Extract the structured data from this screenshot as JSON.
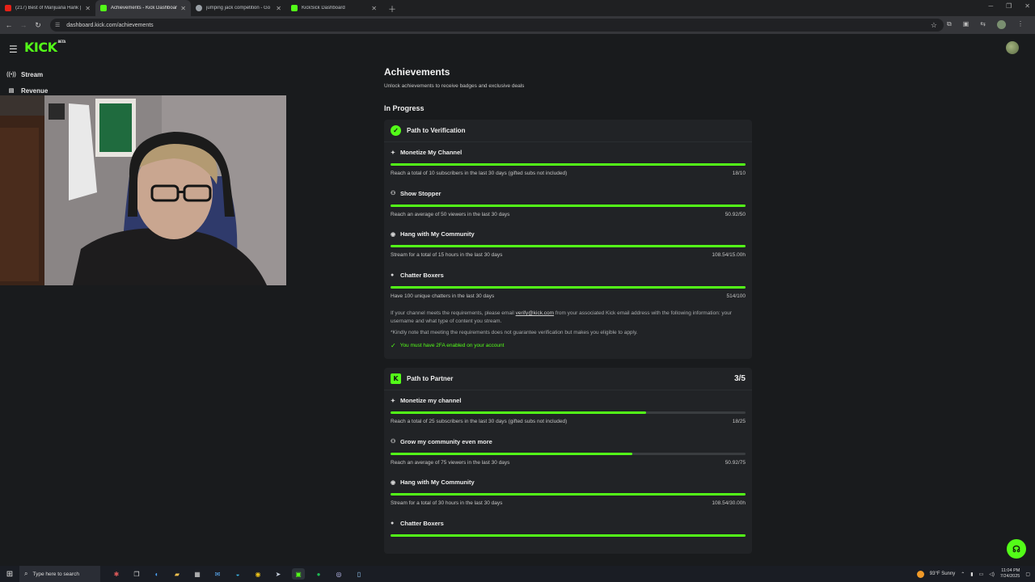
{
  "browser": {
    "tabs": [
      {
        "title": "(217) Best of Marijuana Hank |",
        "favicon_color": "#e62117",
        "active": false
      },
      {
        "title": "Achievements - Kick Dashboard",
        "favicon_color": "#53fc18",
        "active": true
      },
      {
        "title": "jumping jack competition - Go",
        "favicon_color": "#9aa0a6",
        "active": false
      },
      {
        "title": "KickSick Dashboard",
        "favicon_color": "#53fc18",
        "active": false
      }
    ],
    "url": "dashboard.kick.com/achievements"
  },
  "app": {
    "logo": "KICK",
    "logo_sup": "BETA",
    "accent": "#53fc18"
  },
  "sidebar": {
    "items": [
      {
        "label": "Stream",
        "icon": "broadcast-icon"
      },
      {
        "label": "Revenue",
        "icon": "wallet-icon"
      }
    ]
  },
  "main": {
    "title": "Achievements",
    "subtitle": "Unlock achievements to receive badges and exclusive deals",
    "section": "In Progress",
    "verification": {
      "title": "Path to Verification",
      "achievements": [
        {
          "title": "Monetize My Channel",
          "icon": "sparkle-icon",
          "desc": "Reach a total of 10 subscribers in the last 30 days (gifted subs not included)",
          "value": "18/10",
          "progress": 1.0
        },
        {
          "title": "Show Stopper",
          "icon": "viewers-icon",
          "desc": "Reach an average of 50 viewers in the last 30 days",
          "value": "50.92/50",
          "progress": 1.0
        },
        {
          "title": "Hang with My Community",
          "icon": "live-icon",
          "desc": "Stream for a total of 15 hours in the last 30 days",
          "value": "108.54/15.00h",
          "progress": 1.0
        },
        {
          "title": "Chatter Boxers",
          "icon": "chat-icon",
          "desc": "Have 100 unique chatters in the last 30 days",
          "value": "514/100",
          "progress": 1.0
        }
      ],
      "note_prefix": "If your channel meets the requirements, please email ",
      "note_email": "verify@kick.com",
      "note_suffix": " from your associated Kick email address with the following information: your username and what type of content you stream.",
      "disclaimer": "*Kindly note that meeting the requirements does not guarantee verification but makes you eligible to apply.",
      "requirement": "You must have 2FA enabled on your account"
    },
    "partner": {
      "title": "Path to Partner",
      "score": "3/5",
      "achievements": [
        {
          "title": "Monetize my channel",
          "icon": "sparkle-icon",
          "desc": "Reach a total of 25 subscribers in the last 30 days (gifted subs not included)",
          "value": "18/25",
          "progress": 0.72
        },
        {
          "title": "Grow my community even more",
          "icon": "viewers-icon",
          "desc": "Reach an average of 75 viewers in the last 30 days",
          "value": "50.92/75",
          "progress": 0.68
        },
        {
          "title": "Hang with My Community",
          "icon": "live-icon",
          "desc": "Stream for a total of 30 hours in the last 30 days",
          "value": "108.54/30.00h",
          "progress": 1.0
        },
        {
          "title": "Chatter Boxers",
          "icon": "chat-icon",
          "desc": "",
          "value": "",
          "progress": 1.0
        }
      ]
    }
  },
  "taskbar": {
    "search_placeholder": "Type here to search",
    "weather": "93°F  Sunny",
    "time": "11:04 PM",
    "date": "7/24/2025"
  }
}
